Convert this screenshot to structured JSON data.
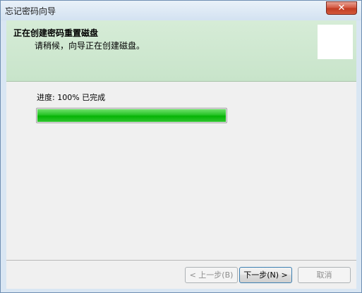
{
  "window": {
    "title": "忘记密码向导",
    "close_label": "✕"
  },
  "header": {
    "title": "正在创建密码重置磁盘",
    "subtitle": "请稍候，向导正在创建磁盘。"
  },
  "progress": {
    "label": "进度: 100% 已完成",
    "value": 1.0
  },
  "buttons": {
    "back": "< 上一步(B)",
    "next": "下一步(N) >",
    "cancel": "取消"
  },
  "colors": {
    "header_bg": "#c8e4ca",
    "progress_green": "#05b405",
    "close_red": "#c03b22"
  }
}
